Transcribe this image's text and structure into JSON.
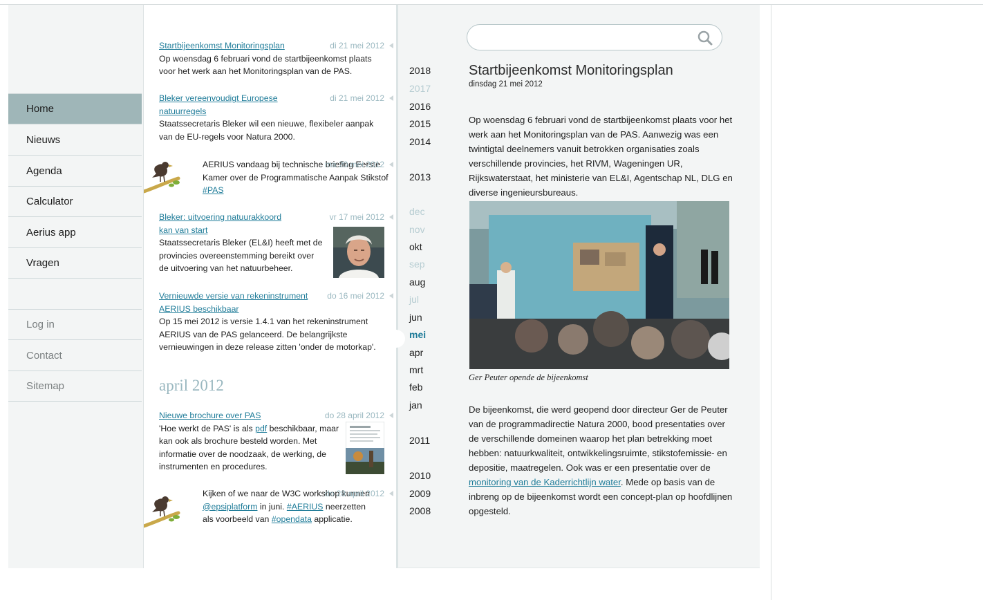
{
  "nav": {
    "items": [
      {
        "label": "Home",
        "active": true
      },
      {
        "label": "Nieuws"
      },
      {
        "label": "Agenda"
      },
      {
        "label": "Calculator"
      },
      {
        "label": "Aerius app"
      },
      {
        "label": "Vragen"
      }
    ],
    "secondary": [
      {
        "label": "Log in"
      },
      {
        "label": "Contact"
      },
      {
        "label": "Sitemap"
      }
    ]
  },
  "news": {
    "items": [
      {
        "title": "Startbijeenkomst Monitoringsplan",
        "date": "di 21 mei 2012",
        "text": "Op woensdag 6 februari vond de startbijeenkomst plaats voor het werk aan het Monitoringsplan van de PAS."
      },
      {
        "title": "Bleker vereenvoudigt Europese natuurregels",
        "date": "di 21 mei 2012",
        "text": "Staatssecretaris Bleker wil een nieuwe, flexibeler aanpak van de EU-regels voor Natura 2000."
      },
      {
        "date": "ma 20 mei 2012",
        "text": "AERIUS vandaag bij technische briefing Eerste Kamer over de Programmatische Aanpak Stikstof ",
        "hashtag": "#PAS"
      },
      {
        "title": "Bleker: uitvoering natuurakkoord kan van start",
        "date": "vr 17 mei 2012",
        "text": "Staatssecretaris Bleker (EL&I) heeft met de provincies overeenstemming bereikt over de uitvoering van het natuurbeheer."
      },
      {
        "title": "Vernieuwde versie van rekeninstrument AERIUS beschikbaar",
        "date": "do 16 mei 2012",
        "text": "Op 15 mei 2012 is versie 1.4.1 van het rekeninstrument AERIUS van de PAS gelanceerd. De belangrijkste vernieuwingen in deze release zitten 'onder de motorkap'."
      }
    ],
    "month_heading": "april 2012",
    "april_items": [
      {
        "title": "Nieuwe brochure over PAS",
        "date": "do 28 april 2012",
        "text_before": "'Hoe werkt de PAS' is als ",
        "link": "pdf",
        "text_after": " beschikbaar, maar kan ook als brochure besteld worden. Met informatie over de noodzaak,  de werking, de instrumenten en procedures."
      },
      {
        "date": "do 28 april 2012",
        "t1": "Kijken of we naar de W3C workshop kunnen ",
        "m1": "@epsiplatform",
        "t2": " in juni. ",
        "m2": "#AERIUS",
        "t3": " neerzetten als voorbeeld van ",
        "m3": "#opendata",
        "t4": " applicatie."
      }
    ]
  },
  "timeline": {
    "years_top": [
      "2018",
      "2017",
      "2016",
      "2015",
      "2014",
      "2013"
    ],
    "months": [
      "dec",
      "nov",
      "okt",
      "sep",
      "aug",
      "jul",
      "jun",
      "mei",
      "apr",
      "mrt",
      "feb",
      "jan"
    ],
    "years_bottom": [
      "2011",
      "2010",
      "2009",
      "2008"
    ],
    "active_month": "mei"
  },
  "search": {
    "placeholder": "",
    "value": ""
  },
  "article": {
    "title": "Startbijeenkomst Monitoringsplan",
    "date": "dinsdag 21 mei 2012",
    "p1": "Op woensdag 6 februari vond de startbijeenkomst plaats voor het werk aan het Monitoringsplan van de PAS. Aanwezig was een twintigtal deelnemers vanuit betrokken organisaties zoals verschillende provincies, het RIVM, Wageningen UR, Rijkswaterstaat, het ministerie van EL&I, Agentschap NL, DLG en diverse ingenieursbureaus.",
    "caption": "Ger Peuter opende de bijeenkomst",
    "p2_before": "De bijeenkomst, die werd geopend door directeur Ger de Peuter van de programmadirectie Natura 2000, bood presentaties over de verschillende domeinen waarop het plan betrekking moet hebben: natuurkwaliteit, ontwikkelingsruimte, stikstofemissie- en depositie, maatregelen. Ook was er een presentatie over de ",
    "p2_link": "monitoring van de Kaderrichtlijn water",
    "p2_after": ". Mede op basis van de inbreng op de bijeenkomst wordt een concept-plan op hoofdlijnen opgesteld."
  },
  "colors": {
    "accent": "#1f7c99",
    "nav_active": "#9fb6b8",
    "date": "#9ab8c0",
    "panel": "#f3f5f5"
  }
}
